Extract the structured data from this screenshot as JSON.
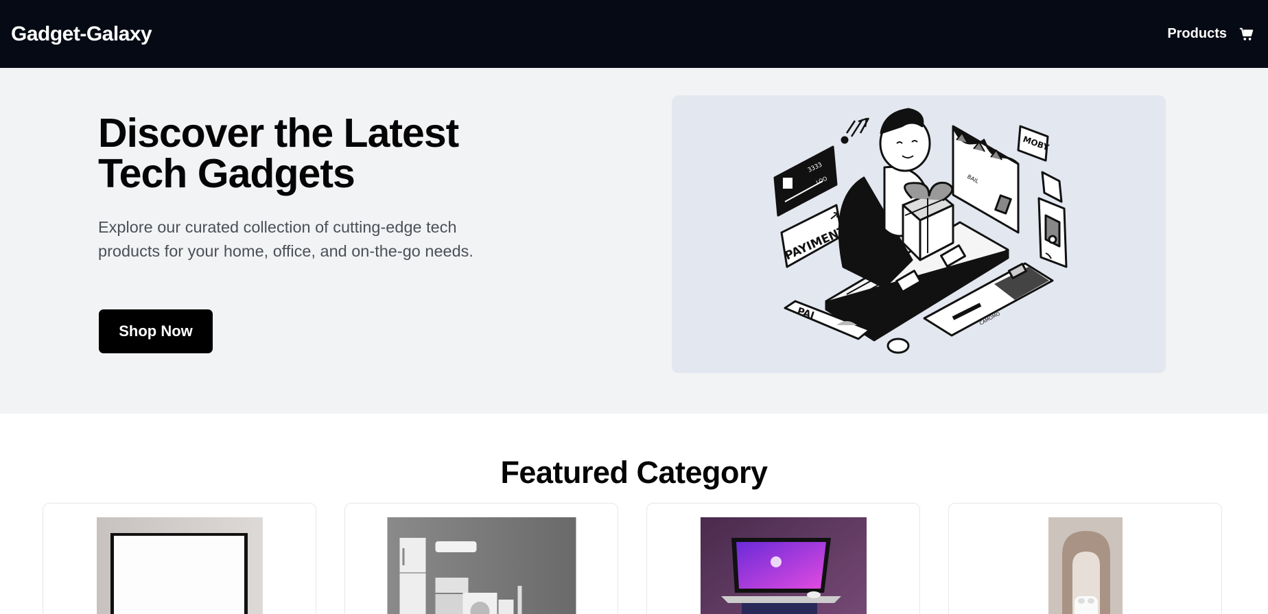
{
  "nav": {
    "brand": "Gadget-Galaxy",
    "products_label": "Products",
    "cart_icon": "shopping-cart-icon"
  },
  "hero": {
    "title": "Discover the Latest Tech Gadgets",
    "description": "Explore our curated collection of cutting-edge tech products for your home, office, and on-the-go needs.",
    "cta_label": "Shop Now",
    "illustration_texts": {
      "payment": "PAYIMENT",
      "moby": "MOBY",
      "pai": "PAI",
      "card_number": "3333",
      "card_small": "LOO",
      "awning": "BAIL",
      "card_brand": "CAMOMO"
    }
  },
  "featured": {
    "title": "Featured Category",
    "cards": [
      {
        "image": "television"
      },
      {
        "image": "home-appliances"
      },
      {
        "image": "laptop"
      },
      {
        "image": "earbuds"
      }
    ]
  },
  "colors": {
    "nav_bg": "#050a14",
    "hero_bg": "#f2f3f5",
    "art_bg": "#e3e7ef",
    "button_bg": "#000000"
  }
}
